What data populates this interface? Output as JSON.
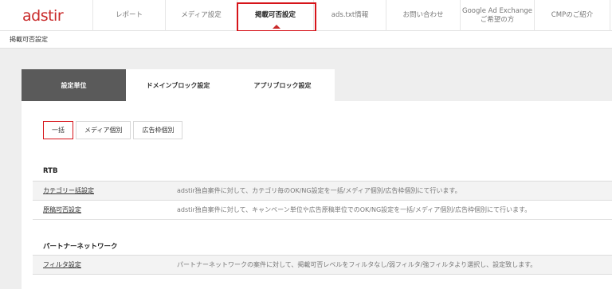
{
  "logo": {
    "text": "adstir"
  },
  "nav": {
    "items": [
      {
        "label": "レポート"
      },
      {
        "label": "メディア設定"
      },
      {
        "label": "掲載可否設定"
      },
      {
        "label": "ads.txt情報"
      },
      {
        "label": "お問い合わせ"
      },
      {
        "label": "Google Ad Exchange\nご希望の方"
      },
      {
        "label": "CMPのご紹介"
      }
    ],
    "active_index": 2
  },
  "breadcrumb": {
    "current": "掲載可否設定"
  },
  "tabs": [
    {
      "label": "設定単位"
    },
    {
      "label": "ドメインブロック設定"
    },
    {
      "label": "アプリブロック設定"
    }
  ],
  "subtabs": [
    {
      "label": "一括"
    },
    {
      "label": "メディア個別"
    },
    {
      "label": "広告枠個別"
    }
  ],
  "sections": [
    {
      "title": "RTB",
      "rows": [
        {
          "name": "カテゴリー括設定",
          "desc": "adstir独自案件に対して、カテゴリ毎のOK/NG設定を一括/メディア個別/広告枠個別にて行います。"
        },
        {
          "name": "原稿可否設定",
          "desc": "adstir独自案件に対して、キャンペーン単位や広告原稿単位でのOK/NG設定を一括/メディア個別/広告枠個別にて行います。"
        }
      ]
    },
    {
      "title": "パートナーネットワーク",
      "rows": [
        {
          "name": "フィルタ設定",
          "desc": "パートナーネットワークの案件に対して、掲載可否レベルをフィルタなし/弱フィルタ/強フィルタより選択し、設定致します。"
        }
      ]
    }
  ],
  "colors": {
    "accent": "#d6141a",
    "brand": "#c92a2a",
    "active_tab": "#5a5a5a"
  }
}
